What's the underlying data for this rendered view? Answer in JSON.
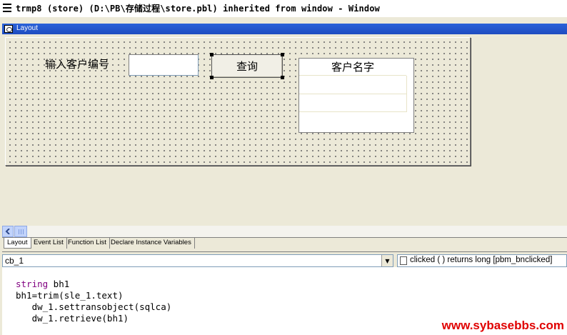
{
  "window": {
    "title": "trmp8 (store) (D:\\PB\\存储过程\\store.pbl) inherited from window - Window"
  },
  "layout_panel": {
    "title": "Layout",
    "controls": {
      "label": "输入客户编号",
      "sle_value": "",
      "button_label": "查询",
      "dw_header": "客户名字"
    }
  },
  "tabs": [
    {
      "label": "Layout",
      "active": true
    },
    {
      "label": "Event List",
      "active": false
    },
    {
      "label": "Function List",
      "active": false
    },
    {
      "label": "Declare Instance Variables",
      "active": false
    }
  ],
  "script": {
    "control": "cb_1",
    "event": "clicked ( )  returns long [pbm_bnclicked]",
    "lines": [
      {
        "kw": "string",
        "rest": " bh1"
      },
      {
        "kw": "",
        "rest": "bh1=trim(sle_1.text)"
      },
      {
        "kw": "",
        "rest": "   dw_1.settransobject(sqlca)"
      },
      {
        "kw": "",
        "rest": "   dw_1.retrieve(bh1)"
      }
    ]
  },
  "watermark": "www.sybasebbs.com"
}
